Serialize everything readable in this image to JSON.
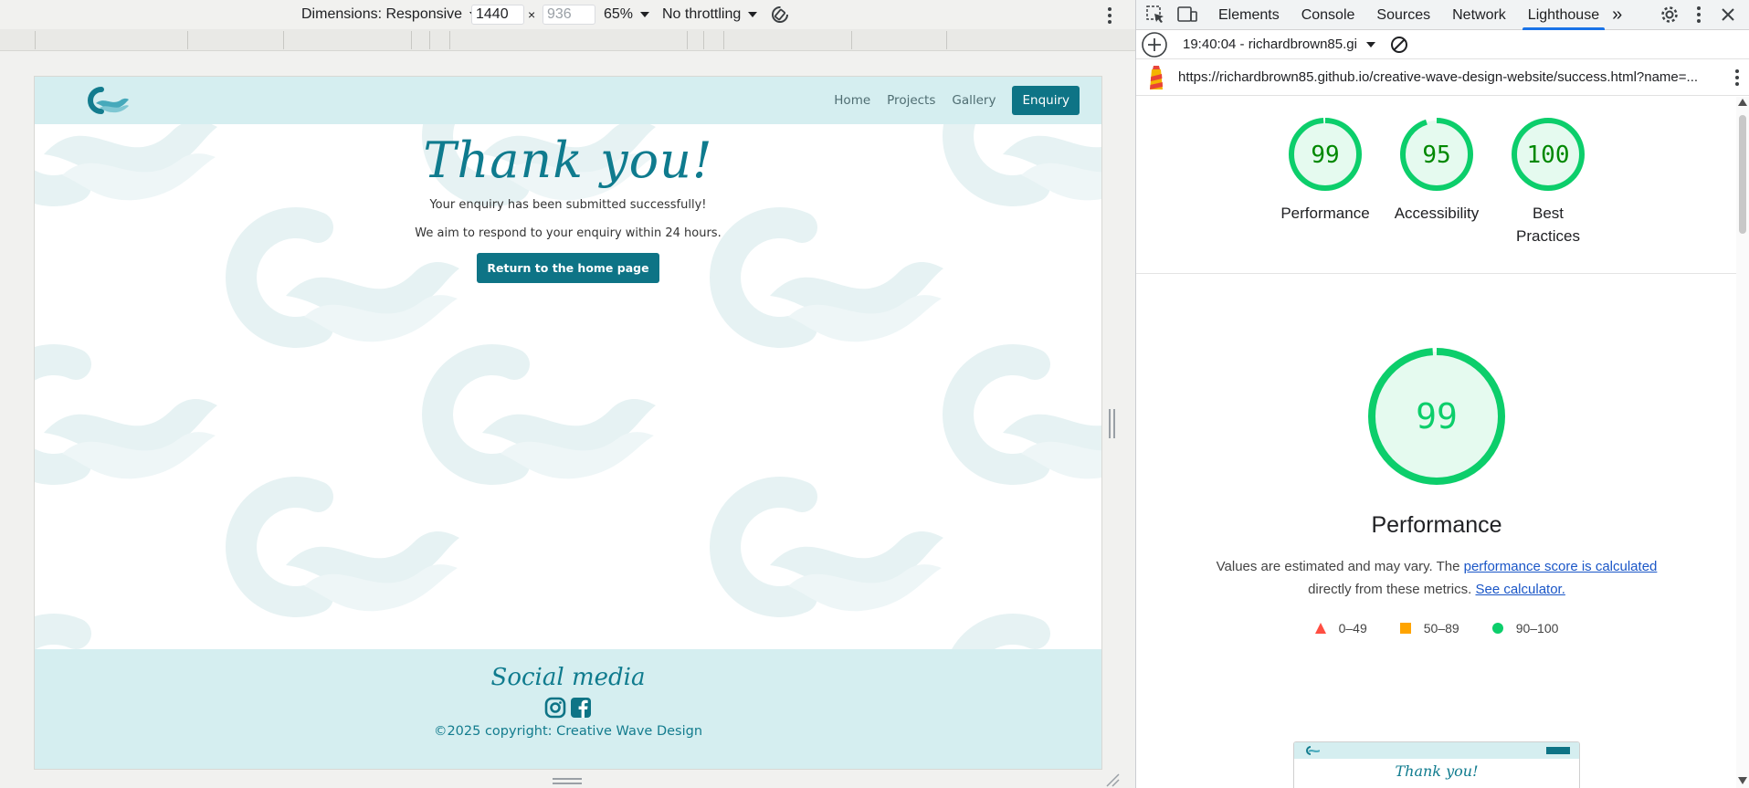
{
  "device_toolbar": {
    "dimensions_label": "Dimensions: Responsive",
    "width_value": "1440",
    "times": "×",
    "height_placeholder": "936",
    "zoom": "65%",
    "throttling": "No throttling"
  },
  "website": {
    "nav": [
      "Home",
      "Projects",
      "Gallery"
    ],
    "enquiry": "Enquiry",
    "heading": "Thank you!",
    "message1": "Your enquiry has been submitted successfully!",
    "message2": "We aim to respond to your enquiry within 24 hours.",
    "home_button": "Return to the home page",
    "social_title": "Social media",
    "copyright": "©2025 copyright: Creative Wave Design",
    "brand_color": "#0e7486",
    "header_bg": "#d5eef0"
  },
  "devtools": {
    "tabs": [
      "Elements",
      "Console",
      "Sources",
      "Network",
      "Lighthouse"
    ],
    "active_tab": "Lighthouse",
    "more_tabs": "»",
    "report_time": "19:40:04 - richardbrown85.gi",
    "url": "https://richardbrown85.github.io/creative-wave-design-website/success.html?name=..."
  },
  "lighthouse": {
    "gauges": [
      {
        "score": "99",
        "label": "Performance"
      },
      {
        "score": "95",
        "label": "Accessibility"
      },
      {
        "score": "100",
        "label": "Best Practices"
      }
    ],
    "gauge_values": [
      99,
      95,
      100
    ],
    "big_score": "99",
    "big_score_value": 99,
    "big_title": "Performance",
    "desc_prefix": "Values are estimated and may vary. The",
    "desc_link1": "performance score is calculated",
    "desc_middle": "directly from these metrics.",
    "desc_link2": "See calculator.",
    "legend": [
      "0–49",
      "50–89",
      "90–100"
    ],
    "colors": {
      "pass": "#0cce6b",
      "pass_text": "#008800",
      "average": "#ffa400",
      "fail": "#ff4e42"
    },
    "thumb_heading": "Thank you!"
  }
}
